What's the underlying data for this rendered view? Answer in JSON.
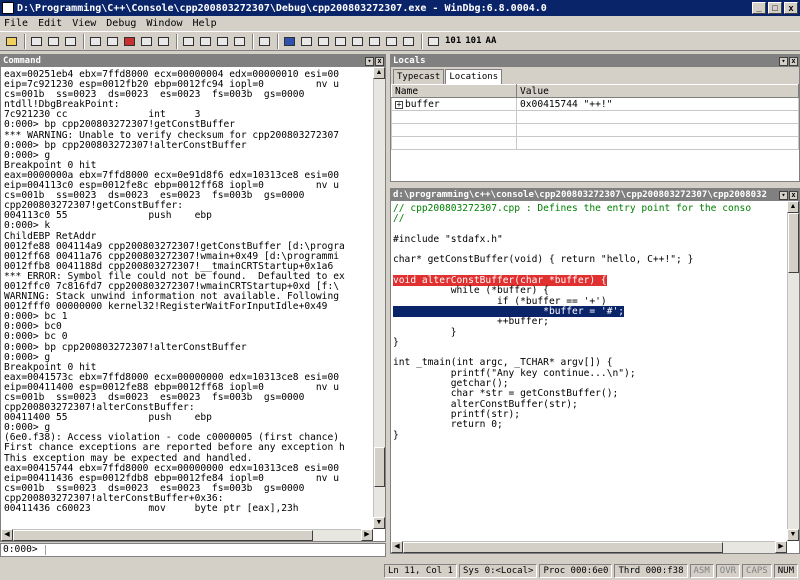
{
  "window": {
    "title": "D:\\Programming\\C++\\Console\\cpp200803272307\\Debug\\cpp200803272307.exe - WinDbg:6.8.0004.0",
    "min": "_",
    "max": "□",
    "close": "x"
  },
  "menu": [
    "File",
    "Edit",
    "View",
    "Debug",
    "Window",
    "Help"
  ],
  "toolbar": {
    "text_a": "101",
    "text_b": "101",
    "font_label": "AA"
  },
  "command": {
    "title": "Command",
    "lines": [
      "eax=00251eb4 ebx=7ffd8000 ecx=00000004 edx=00000010 esi=00",
      "eip=7c921230 esp=0012fb20 ebp=0012fc94 iopl=0         nv u",
      "cs=001b  ss=0023  ds=0023  es=0023  fs=003b  gs=0000",
      "ntdll!DbgBreakPoint:",
      "7c921230 cc              int     3",
      "0:000> bp cpp200803272307!getConstBuffer",
      "*** WARNING: Unable to verify checksum for cpp200803272307",
      "0:000> bp cpp200803272307!alterConstBuffer",
      "0:000> g",
      "Breakpoint 0 hit",
      "eax=0000000a ebx=7ffd8000 ecx=0e91d8f6 edx=10313ce8 esi=00",
      "eip=004113c0 esp=0012fe8c ebp=0012ff68 iopl=0         nv u",
      "cs=001b  ss=0023  ds=0023  es=0023  fs=003b  gs=0000",
      "cpp200803272307!getConstBuffer:",
      "004113c0 55              push    ebp",
      "0:000> k",
      "ChildEBP RetAddr",
      "0012fe88 004114a9 cpp200803272307!getConstBuffer [d:\\progra",
      "0012ff68 00411a76 cpp200803272307!wmain+0x49 [d:\\programmi",
      "0012ffb8 0041188d cpp200803272307!__tmainCRTStartup+0x1a6",
      "*** ERROR: Symbol file could not be found.  Defaulted to ex",
      "0012ffc0 7c816fd7 cpp200803272307!wmainCRTStartup+0xd [f:\\",
      "WARNING: Stack unwind information not available. Following",
      "0012fff0 00000000 kernel32!RegisterWaitForInputIdle+0x49",
      "0:000> bc 1",
      "0:000> bc0",
      "0:000> bc 0",
      "0:000> bp cpp200803272307!alterConstBuffer",
      "0:000> g",
      "Breakpoint 0 hit",
      "eax=0041573c ebx=7ffd8000 ecx=00000000 edx=10313ce8 esi=00",
      "eip=00411400 esp=0012fe88 ebp=0012ff68 iopl=0         nv u",
      "cs=001b  ss=0023  ds=0023  es=0023  fs=003b  gs=0000",
      "cpp200803272307!alterConstBuffer:",
      "00411400 55              push    ebp",
      "0:000> g",
      "(6e0.f38): Access violation - code c0000005 (first chance)",
      "First chance exceptions are reported before any exception h",
      "This exception may be expected and handled.",
      "eax=00415744 ebx=7ffd8000 ecx=00000000 edx=10313ce8 esi=00",
      "eip=00411436 esp=0012fdb8 ebp=0012fe84 iopl=0         nv u",
      "cs=001b  ss=0023  ds=0023  es=0023  fs=003b  gs=0000",
      "cpp200803272307!alterConstBuffer+0x36:",
      "00411436 c60023          mov     byte ptr [eax],23h"
    ]
  },
  "cmd_input": {
    "prompt": "0:000>"
  },
  "locals": {
    "title": "Locals",
    "tabs": [
      "Typecast",
      "Locations"
    ],
    "col_name": "Name",
    "col_value": "Value",
    "rows": [
      {
        "name": "buffer",
        "value": "0x00415744 \"++!\""
      }
    ]
  },
  "source": {
    "title": "d:\\programming\\c++\\console\\cpp200803272307\\cpp200803272307\\cpp2008032",
    "lines": [
      {
        "text": "// cpp200803272307.cpp : Defines the entry point for the conso",
        "cls": "cm"
      },
      {
        "text": "//",
        "cls": "cm"
      },
      {
        "text": "",
        "cls": ""
      },
      {
        "text": "#include \"stdafx.h\"",
        "cls": ""
      },
      {
        "text": "",
        "cls": ""
      },
      {
        "text": "char* getConstBuffer(void) { return \"hello, C++!\"; }",
        "cls": ""
      },
      {
        "text": "",
        "cls": ""
      },
      {
        "text": "void alterConstBuffer(char *buffer) {",
        "cls": "red"
      },
      {
        "text": "          while (*buffer) {",
        "cls": ""
      },
      {
        "text": "                  if (*buffer == '+')",
        "cls": ""
      },
      {
        "text": "                          *buffer = '#';",
        "cls": "blue"
      },
      {
        "text": "                  ++buffer;",
        "cls": ""
      },
      {
        "text": "          }",
        "cls": ""
      },
      {
        "text": "}",
        "cls": ""
      },
      {
        "text": "",
        "cls": ""
      },
      {
        "text": "int _tmain(int argc, _TCHAR* argv[]) {",
        "cls": ""
      },
      {
        "text": "          printf(\"Any key continue...\\n\");",
        "cls": ""
      },
      {
        "text": "          getchar();",
        "cls": ""
      },
      {
        "text": "          char *str = getConstBuffer();",
        "cls": ""
      },
      {
        "text": "          alterConstBuffer(str);",
        "cls": ""
      },
      {
        "text": "          printf(str);",
        "cls": ""
      },
      {
        "text": "          return 0;",
        "cls": ""
      },
      {
        "text": "}",
        "cls": ""
      }
    ]
  },
  "status": {
    "position": "Ln 11, Col 1",
    "sys": "Sys 0:<Local>",
    "proc": "Proc 000:6e0",
    "thrd": "Thrd 000:f38",
    "asm": "ASM",
    "ovr": "OVR",
    "caps": "CAPS",
    "num": "NUM"
  }
}
